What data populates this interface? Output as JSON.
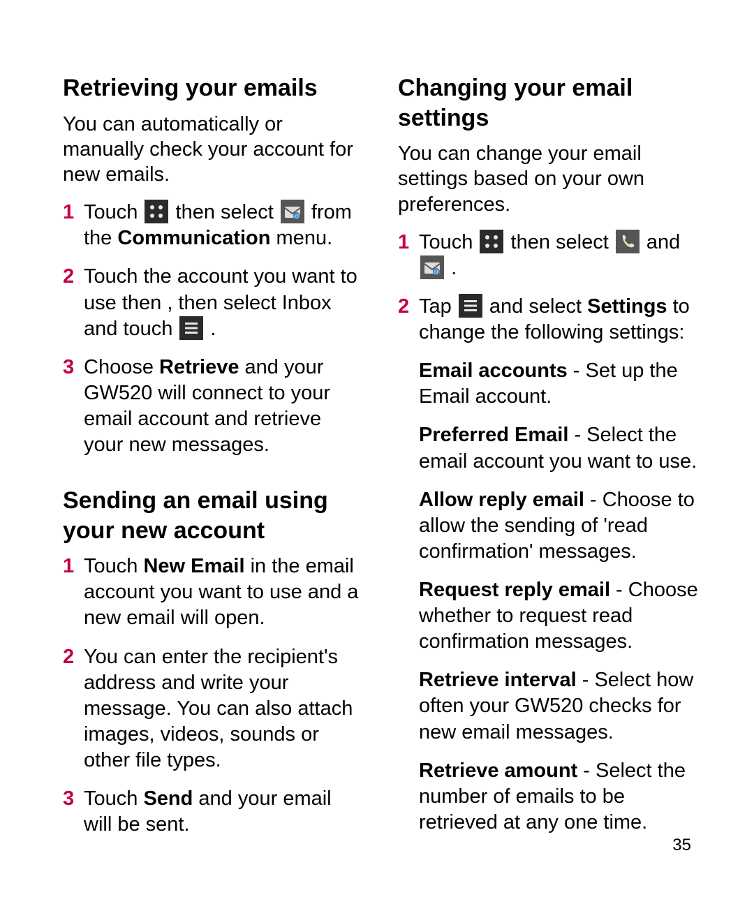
{
  "page_number": "35",
  "left": {
    "section1": {
      "heading": "Retrieving your emails",
      "intro": "You can automatically or manually check your account for new emails.",
      "step1": {
        "a": "Touch ",
        "b": " then select ",
        "c": " from the ",
        "bold": "Communication",
        "d": " menu."
      },
      "step2": {
        "a": "Touch the account you want to use then , then select  Inbox  and touch ",
        "b": " ."
      },
      "step3": {
        "a": "Choose ",
        "bold": "Retrieve",
        "b": " and your GW520 will connect to your email account and retrieve your new messages."
      }
    },
    "section2": {
      "heading": "Sending an email using your new account",
      "step1": {
        "a": "Touch ",
        "bold": "New Email",
        "b": " in the email account you want to use and a new email will open."
      },
      "step2": "You can enter the recipient's address and write your message. You can also attach images, videos, sounds or other file types.",
      "step3": {
        "a": "Touch ",
        "bold": "Send",
        "b": " and your email will be sent."
      }
    }
  },
  "right": {
    "section1": {
      "heading": "Changing your email settings",
      "intro": "You can change your email settings based on your own preferences.",
      "step1": {
        "a": "Touch ",
        "b": " then select ",
        "c": " and ",
        "d": " ."
      },
      "step2": {
        "a": "Tap ",
        "b": " and select ",
        "bold": "Settings",
        "c": " to change the following settings:"
      },
      "settings": {
        "s1": {
          "label": "Email accounts",
          "text": " - Set up the Email account."
        },
        "s2": {
          "label": "Preferred Email",
          "text": " - Select the email account you want to use."
        },
        "s3": {
          "label": "Allow reply email",
          "text": " - Choose to allow the sending of 'read confirmation' messages."
        },
        "s4": {
          "label": "Request reply email",
          "text": " - Choose whether to request read confirmation messages."
        },
        "s5": {
          "label": "Retrieve interval",
          "text": " - Select how often your GW520 checks for new email messages."
        },
        "s6": {
          "label": "Retrieve amount",
          "text": " - Select the number of emails to be retrieved at any one time."
        }
      }
    }
  }
}
